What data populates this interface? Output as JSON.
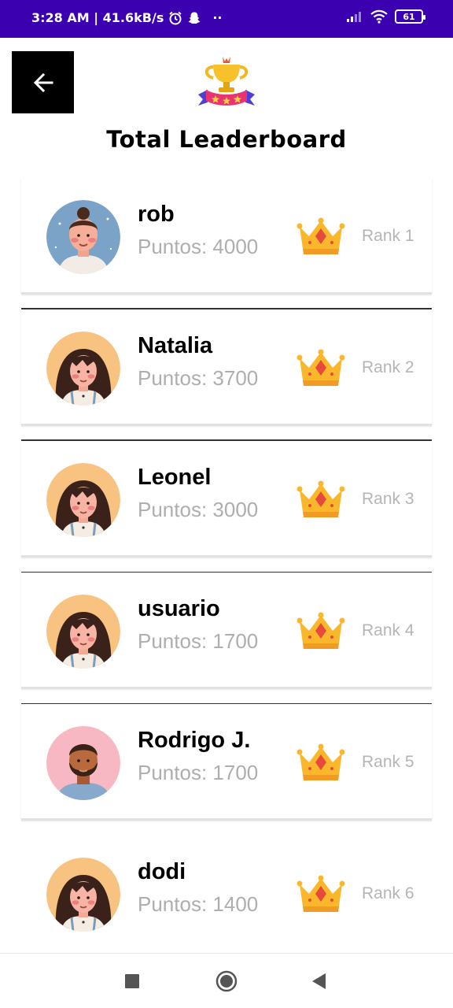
{
  "status_bar": {
    "time_speed": "3:28 AM | 41.6kB/s",
    "alarm_icon": "alarm-icon",
    "snapchat_icon": "ghost-icon",
    "dots": "··",
    "battery": "61",
    "colors": {
      "background": "#3b00b0"
    }
  },
  "header": {
    "back_icon": "arrow-left-icon",
    "logo_icon": "trophy-icon",
    "title": "Total Leaderboard"
  },
  "leaderboard": {
    "entries": [
      {
        "name": "rob",
        "points": "Puntos: 4000",
        "rank": "Rank 1",
        "avatar": "man-bun-avatar"
      },
      {
        "name": "Natalia",
        "points": "Puntos: 3700",
        "rank": "Rank 2",
        "avatar": "woman-bangs-avatar"
      },
      {
        "name": "Leonel",
        "points": "Puntos: 3000",
        "rank": "Rank 3",
        "avatar": "woman-bangs-avatar"
      },
      {
        "name": "usuario",
        "points": "Puntos: 1700",
        "rank": "Rank 4",
        "avatar": "woman-bangs-avatar"
      },
      {
        "name": "Rodrigo J.",
        "points": "Puntos: 1700",
        "rank": "Rank 5",
        "avatar": "bearded-man-avatar"
      },
      {
        "name": "dodi",
        "points": "Puntos: 1400",
        "rank": "Rank 6",
        "avatar": "woman-bangs-avatar"
      }
    ],
    "crown_icon": "crown-icon"
  },
  "nav_bar": {
    "recents_icon": "square-icon",
    "home_icon": "circle-icon",
    "back_icon": "triangle-back-icon"
  }
}
